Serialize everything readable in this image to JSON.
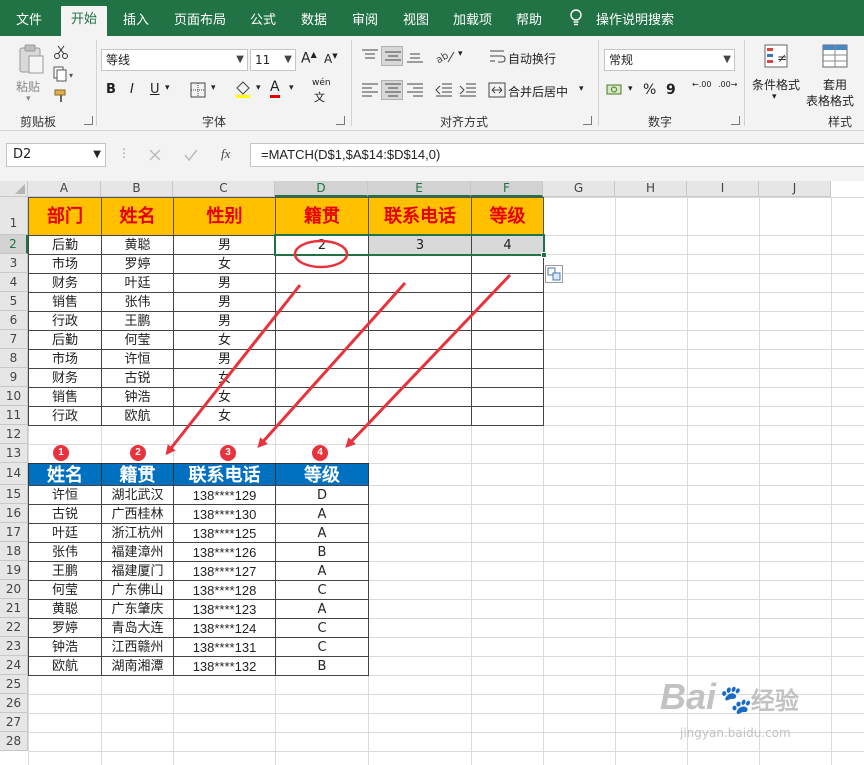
{
  "tabs": [
    "文件",
    "开始",
    "插入",
    "页面布局",
    "公式",
    "数据",
    "审阅",
    "视图",
    "加载项",
    "帮助"
  ],
  "active_tab": "开始",
  "tell_me": "操作说明搜索",
  "ribbon": {
    "clipboard": {
      "label": "剪贴板",
      "paste": "粘贴"
    },
    "font": {
      "label": "字体",
      "name": "等线",
      "size": "11",
      "phonetic": "wén",
      "bold": "B",
      "italic": "I",
      "underline": "U",
      "font_color_letter": "A"
    },
    "alignment": {
      "label": "对齐方式",
      "wrap": "自动换行",
      "merge": "合并后居中"
    },
    "number": {
      "label": "数字",
      "format": "常规",
      "percent": "%",
      "comma": "9",
      "inc_decimal": ".00",
      "dec_decimal": ".00"
    },
    "styles": {
      "label": "样式",
      "conditional": "条件格式",
      "table_format_1": "套用",
      "table_format_2": "表格格式"
    }
  },
  "formula_bar": {
    "name_box": "D2",
    "formula": "=MATCH(D$1,$A$14:$D$14,0)",
    "fx": "fx"
  },
  "columns": [
    "A",
    "B",
    "C",
    "D",
    "E",
    "F",
    "G",
    "H",
    "I",
    "J"
  ],
  "rows": [
    "1",
    "2",
    "3",
    "4",
    "5",
    "6",
    "7",
    "8",
    "9",
    "10",
    "11",
    "12",
    "13",
    "14",
    "15",
    "16",
    "17",
    "18",
    "19",
    "20",
    "21",
    "22",
    "23",
    "24",
    "25",
    "26",
    "27",
    "28"
  ],
  "upper_table": {
    "headers": [
      "部门",
      "姓名",
      "性别",
      "籍贯",
      "联系电话",
      "等级"
    ],
    "match_row": [
      "2",
      "3",
      "4"
    ],
    "rows": [
      [
        "后勤",
        "黄聪",
        "男"
      ],
      [
        "市场",
        "罗婷",
        "女"
      ],
      [
        "财务",
        "叶廷",
        "男"
      ],
      [
        "销售",
        "张伟",
        "男"
      ],
      [
        "行政",
        "王鹏",
        "男"
      ],
      [
        "后勤",
        "何莹",
        "女"
      ],
      [
        "市场",
        "许恒",
        "男"
      ],
      [
        "财务",
        "古锐",
        "女"
      ],
      [
        "销售",
        "钟浩",
        "女"
      ],
      [
        "行政",
        "欧航",
        "女"
      ]
    ]
  },
  "badges": [
    "1",
    "2",
    "3",
    "4"
  ],
  "lower_table": {
    "headers": [
      "姓名",
      "籍贯",
      "联系电话",
      "等级"
    ],
    "rows": [
      [
        "许恒",
        "湖北武汉",
        "138****129",
        "D"
      ],
      [
        "古锐",
        "广西桂林",
        "138****130",
        "A"
      ],
      [
        "叶廷",
        "浙江杭州",
        "138****125",
        "A"
      ],
      [
        "张伟",
        "福建漳州",
        "138****126",
        "B"
      ],
      [
        "王鹏",
        "福建厦门",
        "138****127",
        "A"
      ],
      [
        "何莹",
        "广东佛山",
        "138****128",
        "C"
      ],
      [
        "黄聪",
        "广东肇庆",
        "138****123",
        "A"
      ],
      [
        "罗婷",
        "青岛大连",
        "138****124",
        "C"
      ],
      [
        "钟浩",
        "江西赣州",
        "138****131",
        "C"
      ],
      [
        "欧航",
        "湖南湘潭",
        "138****132",
        "B"
      ]
    ]
  },
  "watermark": {
    "brand": "Bai",
    "brand_cn": "经验",
    "url": "jingyan.baidu.com"
  },
  "colors": {
    "excel_green": "#217346",
    "header_fill": "#ffc000",
    "header_text": "#e60000",
    "blue_header": "#0070c0",
    "annotation_red": "#e8323c"
  }
}
